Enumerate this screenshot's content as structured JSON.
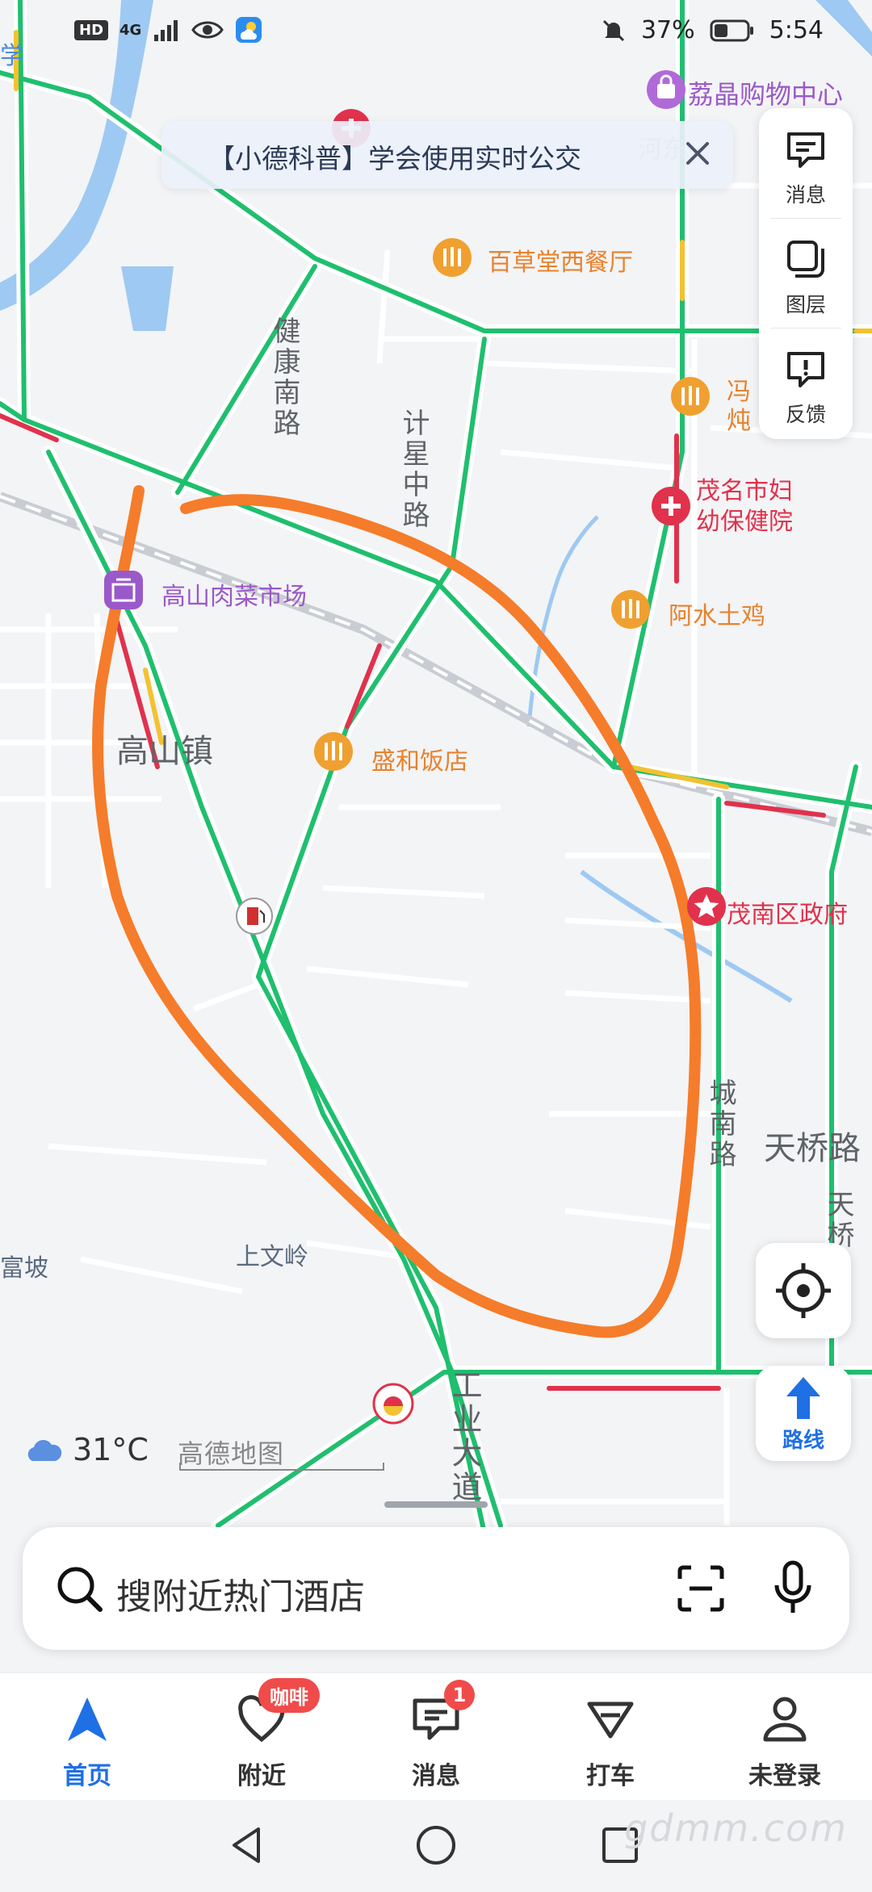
{
  "status_bar": {
    "hd": "HD",
    "network": "4G",
    "battery": "37%",
    "time": "5:54"
  },
  "notice": {
    "text": "【小德科普】学会使用实时公交"
  },
  "tools": {
    "messages_label": "消息",
    "layers_label": "图层",
    "feedback_label": "反馈"
  },
  "map": {
    "pois": {
      "mall": "荔晶购物中心",
      "western_restaurant": "百草堂西餐厅",
      "stew_partial": "冯",
      "stew_partial2": "炖",
      "hospital": "茂名市妇\n幼保健院",
      "chicken": "阿水土鸡",
      "market": "高山肉菜市场",
      "restaurant": "盛和饭店",
      "government": "茂南区政府",
      "top_left_partial": "学",
      "river_partial": "河东"
    },
    "roads": {
      "jiankang": "健康南路",
      "jixing": "计星中路",
      "chengnan": "城南路",
      "tianqiao": "天桥路",
      "tian_partial": "天桥",
      "industrial": "工业大道"
    },
    "places": {
      "gaoshan": "高山镇",
      "shangwenling": "上文岭",
      "fupo_partial": "富坡"
    }
  },
  "weather": {
    "temperature": "31°C"
  },
  "logo": "高德地图",
  "route_button": "路线",
  "search": {
    "placeholder": "搜附近热门酒店"
  },
  "bottom_nav": {
    "items": [
      {
        "label": "首页",
        "active": true
      },
      {
        "label": "附近",
        "badge": "咖啡"
      },
      {
        "label": "消息",
        "badge": "1"
      },
      {
        "label": "打车"
      },
      {
        "label": "未登录"
      }
    ]
  },
  "watermark": "gdmm.com",
  "colors": {
    "road_green": "#1fbf6e",
    "road_red": "#e0324c",
    "road_yellow": "#f2c230",
    "river_blue": "#9ec9f2",
    "annotation_orange": "#f57c2a",
    "accent_blue": "#1f6fe5"
  }
}
